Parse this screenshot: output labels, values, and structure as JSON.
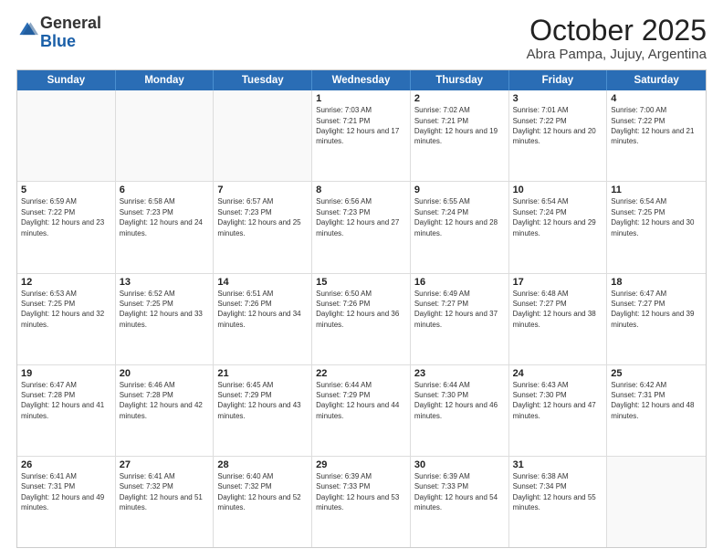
{
  "header": {
    "logo_general": "General",
    "logo_blue": "Blue",
    "month_title": "October 2025",
    "subtitle": "Abra Pampa, Jujuy, Argentina"
  },
  "weekdays": [
    "Sunday",
    "Monday",
    "Tuesday",
    "Wednesday",
    "Thursday",
    "Friday",
    "Saturday"
  ],
  "weeks": [
    [
      {
        "day": "",
        "sunrise": "",
        "sunset": "",
        "daylight": "",
        "empty": true
      },
      {
        "day": "",
        "sunrise": "",
        "sunset": "",
        "daylight": "",
        "empty": true
      },
      {
        "day": "",
        "sunrise": "",
        "sunset": "",
        "daylight": "",
        "empty": true
      },
      {
        "day": "1",
        "sunrise": "Sunrise: 7:03 AM",
        "sunset": "Sunset: 7:21 PM",
        "daylight": "Daylight: 12 hours and 17 minutes.",
        "empty": false
      },
      {
        "day": "2",
        "sunrise": "Sunrise: 7:02 AM",
        "sunset": "Sunset: 7:21 PM",
        "daylight": "Daylight: 12 hours and 19 minutes.",
        "empty": false
      },
      {
        "day": "3",
        "sunrise": "Sunrise: 7:01 AM",
        "sunset": "Sunset: 7:22 PM",
        "daylight": "Daylight: 12 hours and 20 minutes.",
        "empty": false
      },
      {
        "day": "4",
        "sunrise": "Sunrise: 7:00 AM",
        "sunset": "Sunset: 7:22 PM",
        "daylight": "Daylight: 12 hours and 21 minutes.",
        "empty": false
      }
    ],
    [
      {
        "day": "5",
        "sunrise": "Sunrise: 6:59 AM",
        "sunset": "Sunset: 7:22 PM",
        "daylight": "Daylight: 12 hours and 23 minutes.",
        "empty": false
      },
      {
        "day": "6",
        "sunrise": "Sunrise: 6:58 AM",
        "sunset": "Sunset: 7:23 PM",
        "daylight": "Daylight: 12 hours and 24 minutes.",
        "empty": false
      },
      {
        "day": "7",
        "sunrise": "Sunrise: 6:57 AM",
        "sunset": "Sunset: 7:23 PM",
        "daylight": "Daylight: 12 hours and 25 minutes.",
        "empty": false
      },
      {
        "day": "8",
        "sunrise": "Sunrise: 6:56 AM",
        "sunset": "Sunset: 7:23 PM",
        "daylight": "Daylight: 12 hours and 27 minutes.",
        "empty": false
      },
      {
        "day": "9",
        "sunrise": "Sunrise: 6:55 AM",
        "sunset": "Sunset: 7:24 PM",
        "daylight": "Daylight: 12 hours and 28 minutes.",
        "empty": false
      },
      {
        "day": "10",
        "sunrise": "Sunrise: 6:54 AM",
        "sunset": "Sunset: 7:24 PM",
        "daylight": "Daylight: 12 hours and 29 minutes.",
        "empty": false
      },
      {
        "day": "11",
        "sunrise": "Sunrise: 6:54 AM",
        "sunset": "Sunset: 7:25 PM",
        "daylight": "Daylight: 12 hours and 30 minutes.",
        "empty": false
      }
    ],
    [
      {
        "day": "12",
        "sunrise": "Sunrise: 6:53 AM",
        "sunset": "Sunset: 7:25 PM",
        "daylight": "Daylight: 12 hours and 32 minutes.",
        "empty": false
      },
      {
        "day": "13",
        "sunrise": "Sunrise: 6:52 AM",
        "sunset": "Sunset: 7:25 PM",
        "daylight": "Daylight: 12 hours and 33 minutes.",
        "empty": false
      },
      {
        "day": "14",
        "sunrise": "Sunrise: 6:51 AM",
        "sunset": "Sunset: 7:26 PM",
        "daylight": "Daylight: 12 hours and 34 minutes.",
        "empty": false
      },
      {
        "day": "15",
        "sunrise": "Sunrise: 6:50 AM",
        "sunset": "Sunset: 7:26 PM",
        "daylight": "Daylight: 12 hours and 36 minutes.",
        "empty": false
      },
      {
        "day": "16",
        "sunrise": "Sunrise: 6:49 AM",
        "sunset": "Sunset: 7:27 PM",
        "daylight": "Daylight: 12 hours and 37 minutes.",
        "empty": false
      },
      {
        "day": "17",
        "sunrise": "Sunrise: 6:48 AM",
        "sunset": "Sunset: 7:27 PM",
        "daylight": "Daylight: 12 hours and 38 minutes.",
        "empty": false
      },
      {
        "day": "18",
        "sunrise": "Sunrise: 6:47 AM",
        "sunset": "Sunset: 7:27 PM",
        "daylight": "Daylight: 12 hours and 39 minutes.",
        "empty": false
      }
    ],
    [
      {
        "day": "19",
        "sunrise": "Sunrise: 6:47 AM",
        "sunset": "Sunset: 7:28 PM",
        "daylight": "Daylight: 12 hours and 41 minutes.",
        "empty": false
      },
      {
        "day": "20",
        "sunrise": "Sunrise: 6:46 AM",
        "sunset": "Sunset: 7:28 PM",
        "daylight": "Daylight: 12 hours and 42 minutes.",
        "empty": false
      },
      {
        "day": "21",
        "sunrise": "Sunrise: 6:45 AM",
        "sunset": "Sunset: 7:29 PM",
        "daylight": "Daylight: 12 hours and 43 minutes.",
        "empty": false
      },
      {
        "day": "22",
        "sunrise": "Sunrise: 6:44 AM",
        "sunset": "Sunset: 7:29 PM",
        "daylight": "Daylight: 12 hours and 44 minutes.",
        "empty": false
      },
      {
        "day": "23",
        "sunrise": "Sunrise: 6:44 AM",
        "sunset": "Sunset: 7:30 PM",
        "daylight": "Daylight: 12 hours and 46 minutes.",
        "empty": false
      },
      {
        "day": "24",
        "sunrise": "Sunrise: 6:43 AM",
        "sunset": "Sunset: 7:30 PM",
        "daylight": "Daylight: 12 hours and 47 minutes.",
        "empty": false
      },
      {
        "day": "25",
        "sunrise": "Sunrise: 6:42 AM",
        "sunset": "Sunset: 7:31 PM",
        "daylight": "Daylight: 12 hours and 48 minutes.",
        "empty": false
      }
    ],
    [
      {
        "day": "26",
        "sunrise": "Sunrise: 6:41 AM",
        "sunset": "Sunset: 7:31 PM",
        "daylight": "Daylight: 12 hours and 49 minutes.",
        "empty": false
      },
      {
        "day": "27",
        "sunrise": "Sunrise: 6:41 AM",
        "sunset": "Sunset: 7:32 PM",
        "daylight": "Daylight: 12 hours and 51 minutes.",
        "empty": false
      },
      {
        "day": "28",
        "sunrise": "Sunrise: 6:40 AM",
        "sunset": "Sunset: 7:32 PM",
        "daylight": "Daylight: 12 hours and 52 minutes.",
        "empty": false
      },
      {
        "day": "29",
        "sunrise": "Sunrise: 6:39 AM",
        "sunset": "Sunset: 7:33 PM",
        "daylight": "Daylight: 12 hours and 53 minutes.",
        "empty": false
      },
      {
        "day": "30",
        "sunrise": "Sunrise: 6:39 AM",
        "sunset": "Sunset: 7:33 PM",
        "daylight": "Daylight: 12 hours and 54 minutes.",
        "empty": false
      },
      {
        "day": "31",
        "sunrise": "Sunrise: 6:38 AM",
        "sunset": "Sunset: 7:34 PM",
        "daylight": "Daylight: 12 hours and 55 minutes.",
        "empty": false
      },
      {
        "day": "",
        "sunrise": "",
        "sunset": "",
        "daylight": "",
        "empty": true
      }
    ]
  ]
}
